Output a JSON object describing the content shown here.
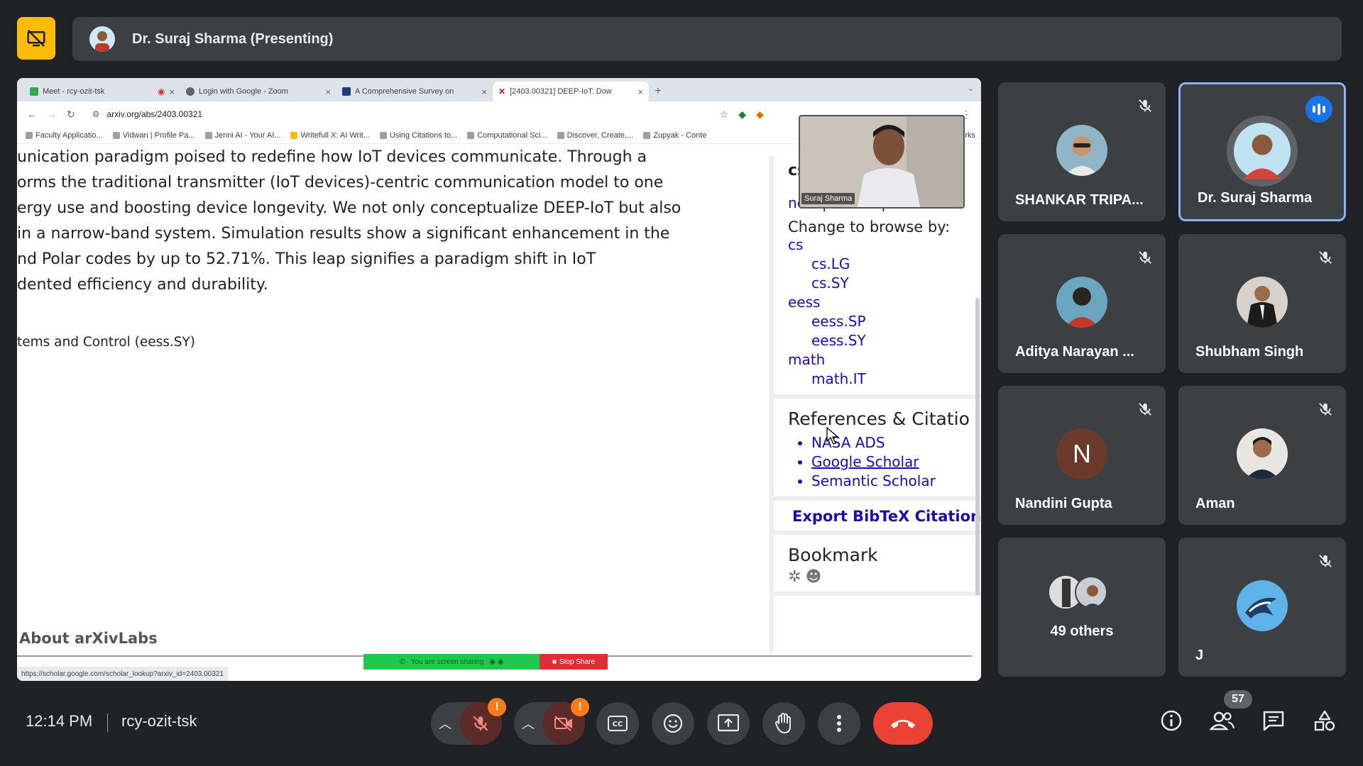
{
  "presenting": {
    "title": "Dr. Suraj Sharma (Presenting)"
  },
  "browser": {
    "tabs": [
      {
        "label": "Meet - rcy-ozit-tsk",
        "active": false
      },
      {
        "label": "Login with Google - Zoom",
        "active": false
      },
      {
        "label": "A Comprehensive Survey on",
        "active": false
      },
      {
        "label": "[2403.00321] DEEP-IoT: Dow",
        "active": true
      }
    ],
    "url": "arxiv.org/abs/2403.00321",
    "bookmarks": [
      "Faculty Applicatio...",
      "Vidwan | Profile Pa...",
      "Jenni AI - Your AI...",
      "Writefull X: AI Writ...",
      "Using Citations to...",
      "Computational Sci...",
      "Discover, Create,...",
      "Zupyak - Conte"
    ],
    "bookmarks_overflow": "rks",
    "status_url": "https://scholar.google.com/scholar_lookup?arxiv_id=2403.00321"
  },
  "arxiv": {
    "abstract_lines": [
      "unication paradigm poised to redefine how IoT devices communicate. Through a",
      "orms the traditional transmitter (IoT devices)-centric communication model to one",
      "ergy use and boosting device longevity. We not only conceptualize DEEP-IoT but also",
      "in a narrow-band system. Simulation results show a significant enhancement in the",
      "nd Polar codes by up to 52.71%. This leap signifies a paradigm shift in IoT",
      "dented efficiency and durability."
    ],
    "subjects": "tems and Control (eess.SY)",
    "about": "About arXivLabs",
    "sidebar": {
      "cs_head": "cs",
      "nav": "new | recent | 2403",
      "browse_head": "Change to browse by:",
      "browse": [
        {
          "label": "cs",
          "indent": false
        },
        {
          "label": "cs.LG",
          "indent": true
        },
        {
          "label": "cs.SY",
          "indent": true
        },
        {
          "label": "eess",
          "indent": false
        },
        {
          "label": "eess.SP",
          "indent": true
        },
        {
          "label": "eess.SY",
          "indent": true
        },
        {
          "label": "math",
          "indent": false
        },
        {
          "label": "math.IT",
          "indent": true
        }
      ],
      "refs_title": "References & Citatio",
      "refs": [
        "NASA ADS",
        "Google Scholar",
        "Semantic Scholar"
      ],
      "export": "Export BibTeX Citation",
      "bookmark_title": "Bookmark"
    },
    "camera_label": "Suraj Sharma",
    "sharing_text": "You are screen sharing",
    "stop_share": "Stop Share"
  },
  "participants": [
    {
      "name": "SHANKAR TRIPA...",
      "muted": true,
      "avatar": "photo"
    },
    {
      "name": "Dr. Suraj Sharma",
      "muted": false,
      "speaking": true,
      "avatar": "photo"
    },
    {
      "name": "Aditya Narayan ...",
      "muted": true,
      "avatar": "photo"
    },
    {
      "name": "Shubham Singh",
      "muted": true,
      "avatar": "photo"
    },
    {
      "name": "Nandini Gupta",
      "muted": true,
      "initial": "N"
    },
    {
      "name": "Aman",
      "muted": true,
      "avatar": "photo"
    },
    {
      "name": "49 others"
    },
    {
      "name": "J",
      "muted": true,
      "avatar": "photo"
    }
  ],
  "footer": {
    "time": "12:14 PM",
    "meeting_code": "rcy-ozit-tsk",
    "people_count": "57",
    "warn_mark": "!"
  },
  "colors": {
    "background": "#202124",
    "tile": "#3c4043",
    "accent_blue": "#8ab4f8",
    "end_call": "#ea4335",
    "present_yellow": "#fbbc04",
    "warning_orange": "#fa7b17"
  }
}
